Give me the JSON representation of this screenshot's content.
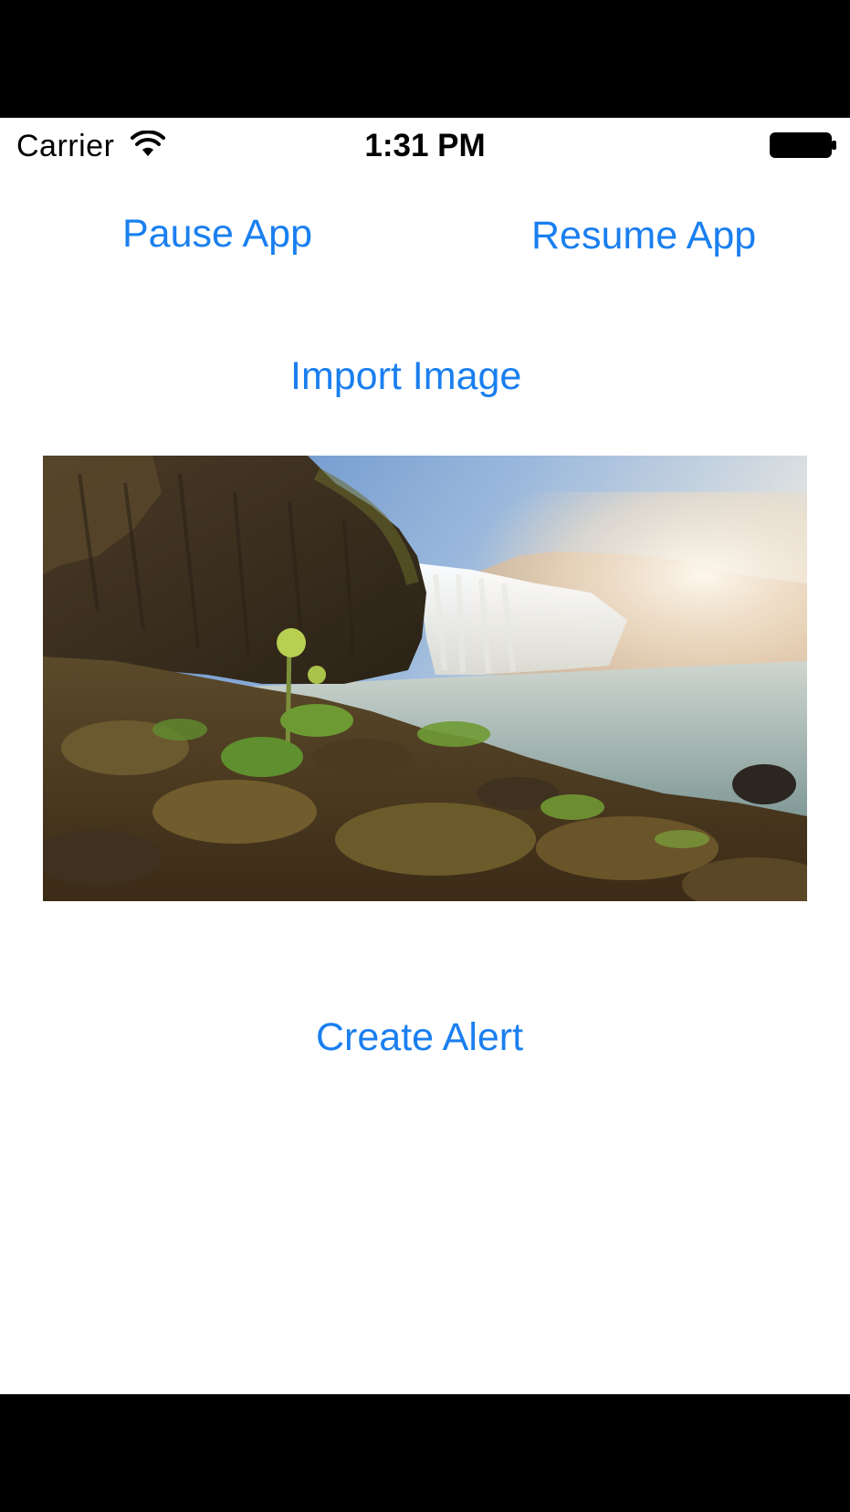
{
  "status_bar": {
    "carrier": "Carrier",
    "time": "1:31 PM",
    "wifi_icon": "wifi-icon",
    "battery_icon": "battery-full-icon"
  },
  "controls": {
    "pause_label": "Pause App",
    "resume_label": "Resume App",
    "import_label": "Import Image",
    "alert_label": "Create Alert"
  },
  "image": {
    "subject": "waterfall landscape photo"
  },
  "colors": {
    "accent": "#1a7ff0",
    "background": "#ffffff",
    "bezel": "#000000"
  }
}
